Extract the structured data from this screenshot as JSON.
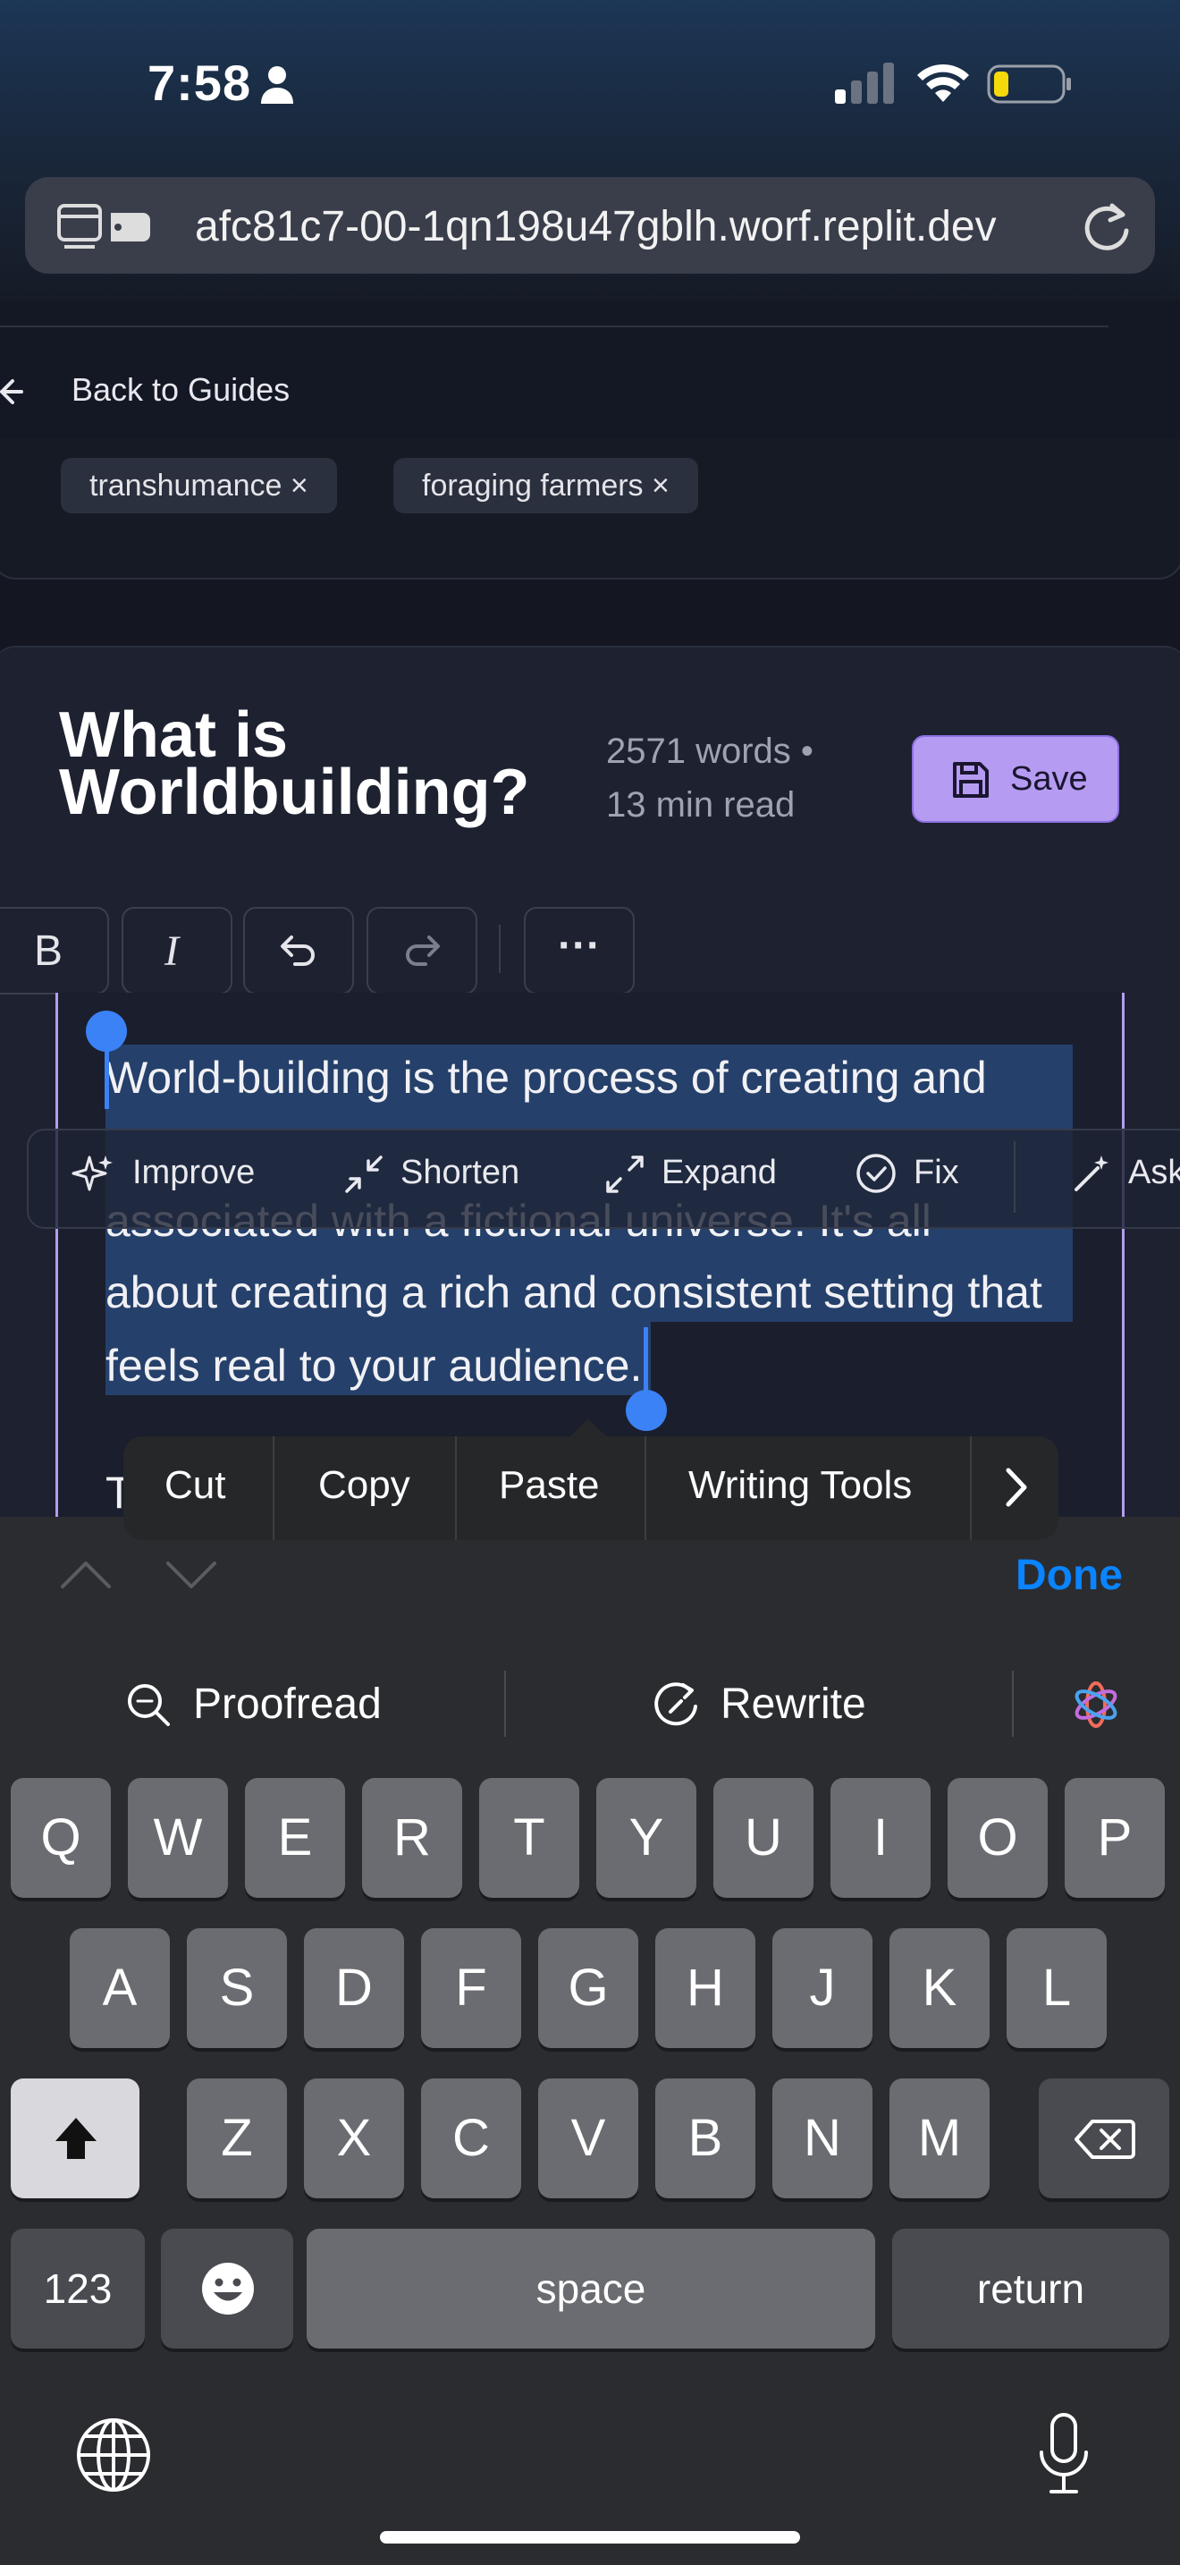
{
  "status_bar": {
    "time": "7:58"
  },
  "browser": {
    "url": "afc81c7-00-1qn198u47gblh.worf.replit.dev"
  },
  "nav": {
    "back_label": "Back to Guides"
  },
  "tags": [
    "transhumance ×",
    "foraging farmers ×"
  ],
  "article": {
    "title": "What is Worldbuilding?",
    "word_count": "2571 words •",
    "read_time": "13 min read",
    "save_label": "Save"
  },
  "editor": {
    "toolbar": {
      "bold": "B",
      "italic": "I",
      "more": "···"
    },
    "content": {
      "line1": "World-building is the process of creating and",
      "line2": "associated with a fictional universe. It's all",
      "line3": "about creating a rich and consistent setting that",
      "line4": "feels real to your audience.",
      "next_para_start": "T"
    },
    "ai_tools": [
      "Improve",
      "Shorten",
      "Expand",
      "Fix",
      "Ask"
    ]
  },
  "context_menu": {
    "items": [
      "Cut",
      "Copy",
      "Paste",
      "Writing Tools"
    ]
  },
  "keyboard": {
    "done_label": "Done",
    "writing_tools": {
      "proofread": "Proofread",
      "rewrite": "Rewrite"
    },
    "rows": [
      [
        "Q",
        "W",
        "E",
        "R",
        "T",
        "Y",
        "U",
        "I",
        "O",
        "P"
      ],
      [
        "A",
        "S",
        "D",
        "F",
        "G",
        "H",
        "J",
        "K",
        "L"
      ],
      [
        "Z",
        "X",
        "C",
        "V",
        "B",
        "N",
        "M"
      ]
    ],
    "numbers_label": "123",
    "space_label": "space",
    "return_label": "return"
  },
  "colors": {
    "accent": "#b59cf2",
    "selection": "#25406a",
    "ios_blue": "#0a84ff",
    "handle": "#3b82f6"
  }
}
